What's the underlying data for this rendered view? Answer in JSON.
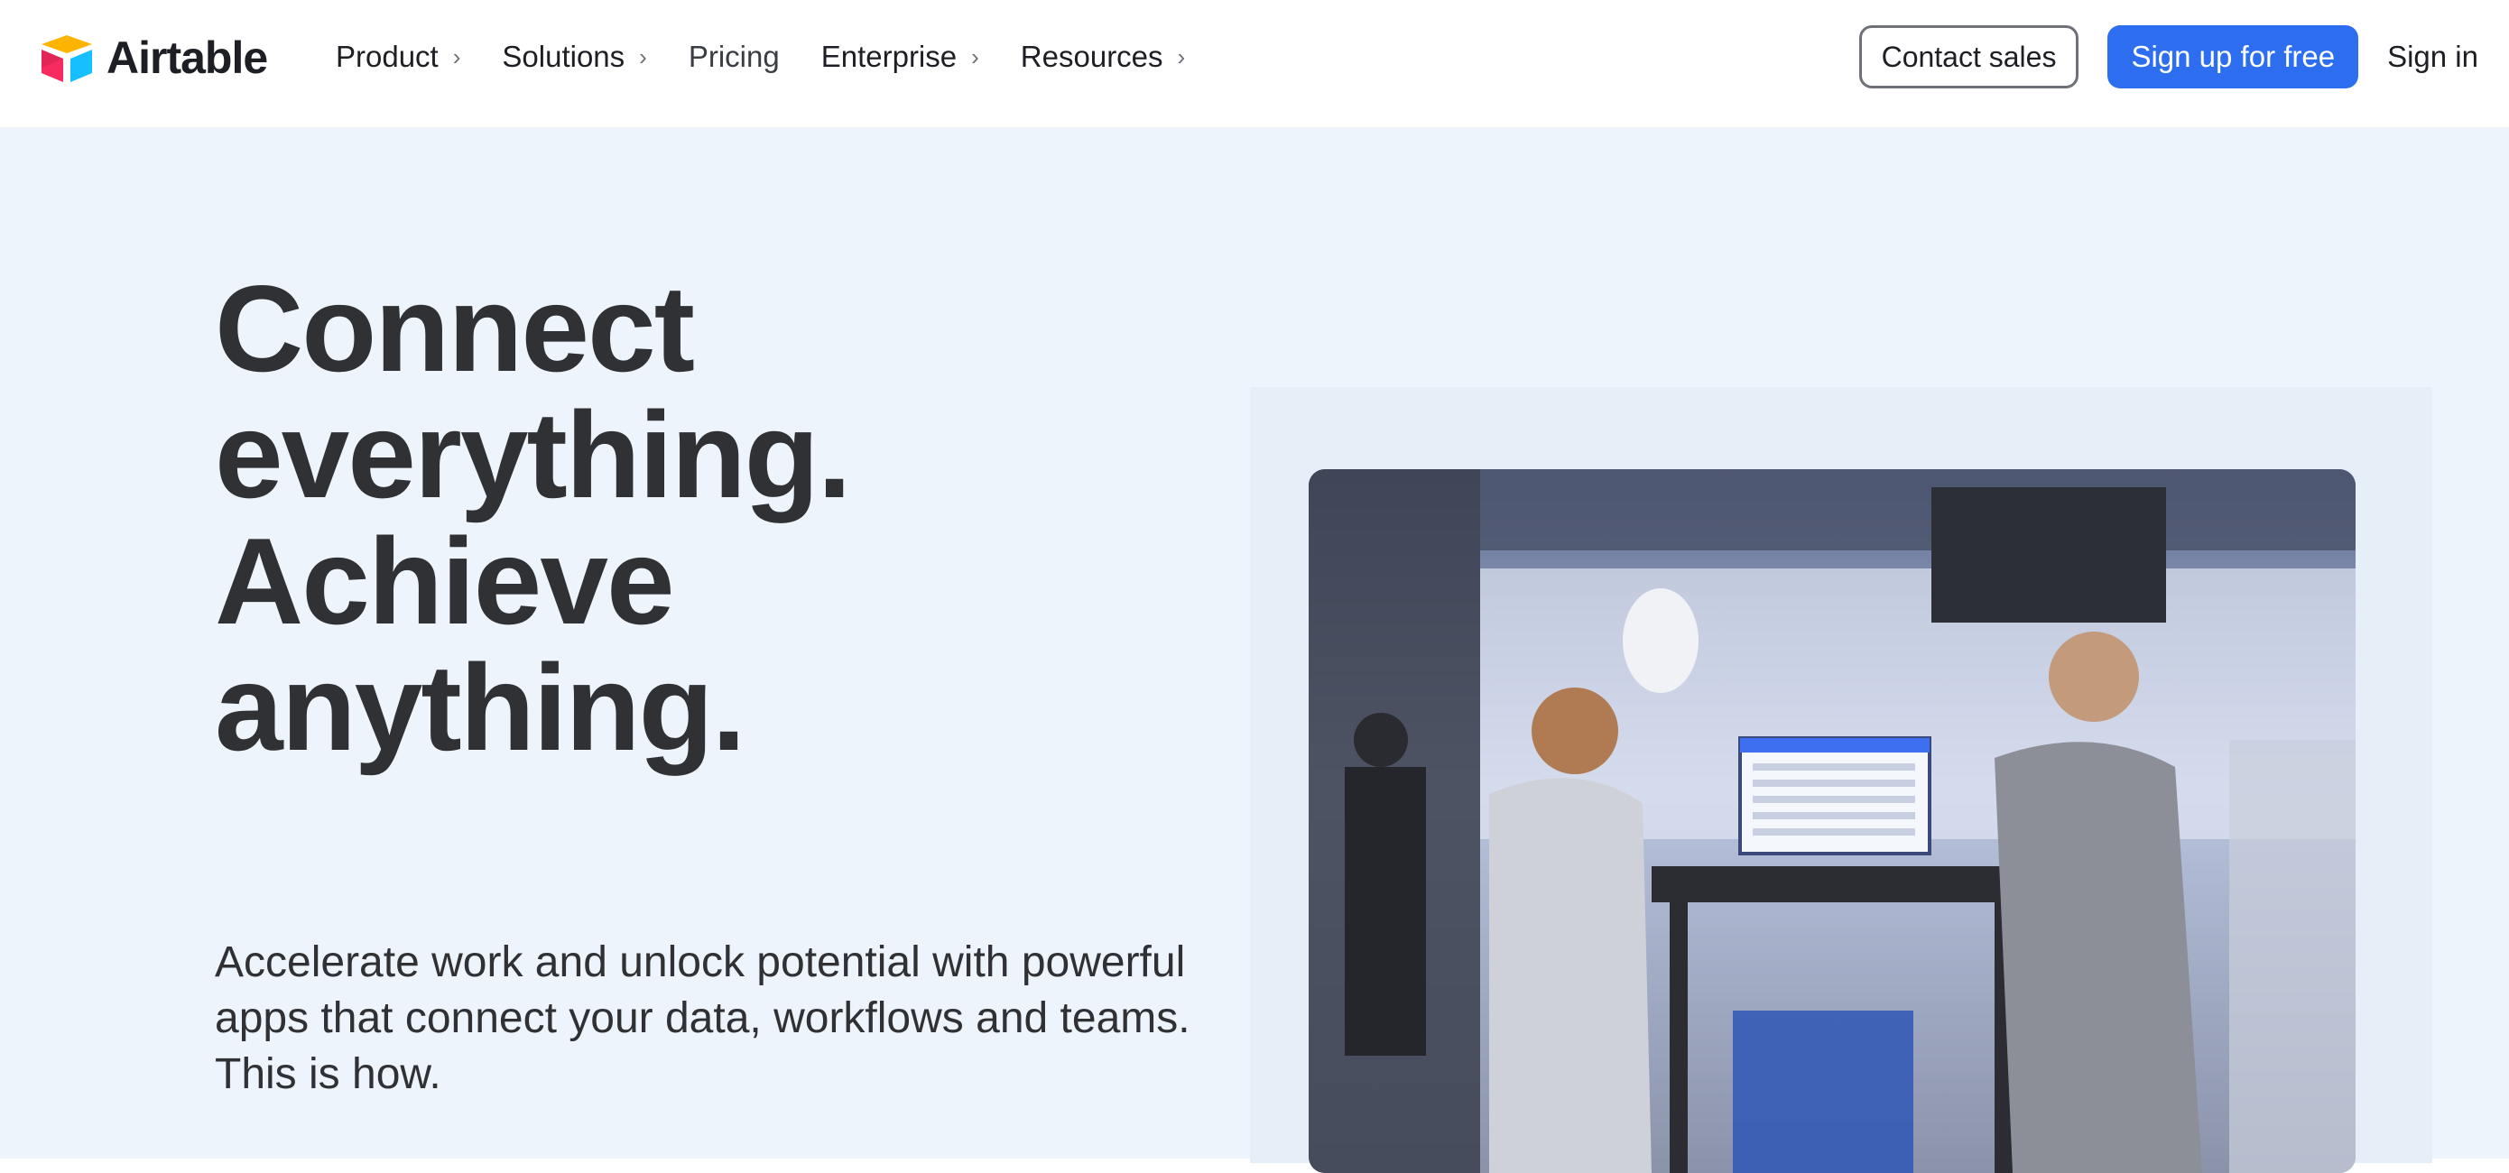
{
  "brand": {
    "name": "Airtable"
  },
  "nav": {
    "items": [
      {
        "label": "Product",
        "has_menu": true
      },
      {
        "label": "Solutions",
        "has_menu": true
      },
      {
        "label": "Pricing",
        "has_menu": false
      },
      {
        "label": "Enterprise",
        "has_menu": true
      },
      {
        "label": "Resources",
        "has_menu": true
      }
    ],
    "contact_sales": "Contact sales",
    "signup": "Sign up for free",
    "signin": "Sign in"
  },
  "hero": {
    "headline": [
      "Connect",
      "everything.",
      "Achieve",
      "anything."
    ],
    "subhead": "Accelerate work and unlock potential with powerful apps that connect your data, workflows and teams. This is how."
  },
  "colors": {
    "accent": "#2d6ef1",
    "hero_bg": "#edf4fb",
    "text": "#2f3134"
  }
}
